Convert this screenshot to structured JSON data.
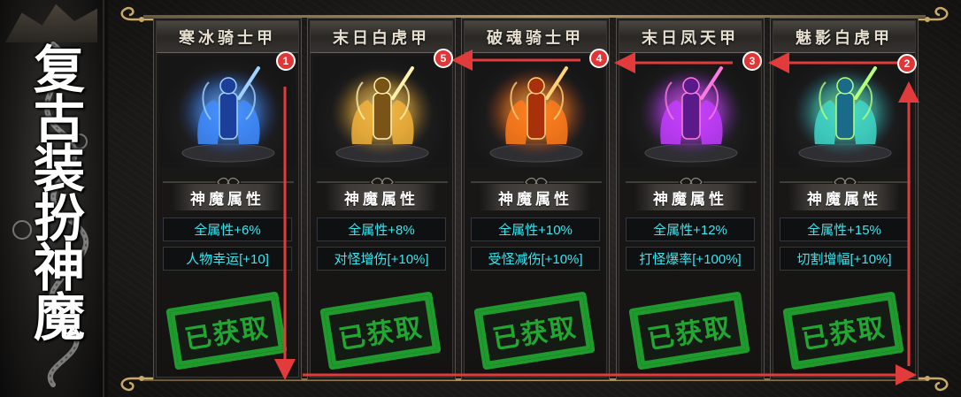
{
  "banner": {
    "title": "复古装扮神魔"
  },
  "section": {
    "attr_header": "神魔属性",
    "stamp_label": "已获取"
  },
  "colors": {
    "stat_text": "#39e6ef",
    "stamp_green": "#22a632",
    "badge_red": "#e23636",
    "arrow_red": "#e23b3b"
  },
  "cards": [
    {
      "title": "寒冰骑士甲",
      "order": "1",
      "stat1": "全属性+6%",
      "stat2": "人物幸运[+10]",
      "theme": "ice"
    },
    {
      "title": "末日白虎甲",
      "order": "5",
      "stat1": "全属性+8%",
      "stat2": "对怪增伤[+10%]",
      "theme": "gold"
    },
    {
      "title": "破魂骑士甲",
      "order": "4",
      "stat1": "全属性+10%",
      "stat2": "受怪减伤[+10%]",
      "theme": "fire"
    },
    {
      "title": "末日凤天甲",
      "order": "3",
      "stat1": "全属性+12%",
      "stat2": "打怪爆率[+100%]",
      "theme": "purple"
    },
    {
      "title": "魅影白虎甲",
      "order": "2",
      "stat1": "全属性+15%",
      "stat2": "切割增幅[+10%]",
      "theme": "jade"
    }
  ]
}
